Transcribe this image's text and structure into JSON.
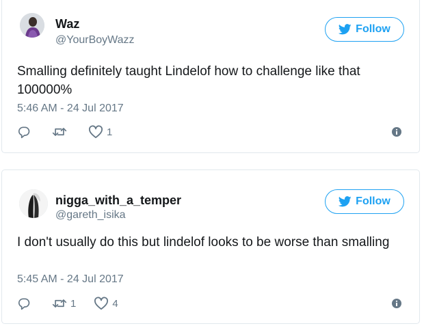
{
  "tweets": [
    {
      "author_name": "Waz",
      "author_handle": "@YourBoyWazz",
      "follow_label": "Follow",
      "text": "Smalling definitely taught Lindelof how to challenge like that 100000%",
      "timestamp": "5:46 AM - 24 Jul 2017",
      "reply_count": "",
      "retweet_count": "",
      "like_count": "1"
    },
    {
      "author_name": "nigga_with_a_temper",
      "author_handle": "@gareth_isika",
      "follow_label": "Follow",
      "text": "I don't usually do this but lindelof looks to be worse than smalling",
      "timestamp": "5:45 AM - 24 Jul 2017",
      "reply_count": "",
      "retweet_count": "1",
      "like_count": "4"
    }
  ],
  "icons": {
    "reply": "reply-icon",
    "retweet": "retweet-icon",
    "like": "heart-icon",
    "info": "info-icon",
    "follow": "twitter-bird-icon"
  },
  "colors": {
    "accent": "#1da1f2",
    "secondary_text": "#657786",
    "border": "#e1e8ed"
  }
}
